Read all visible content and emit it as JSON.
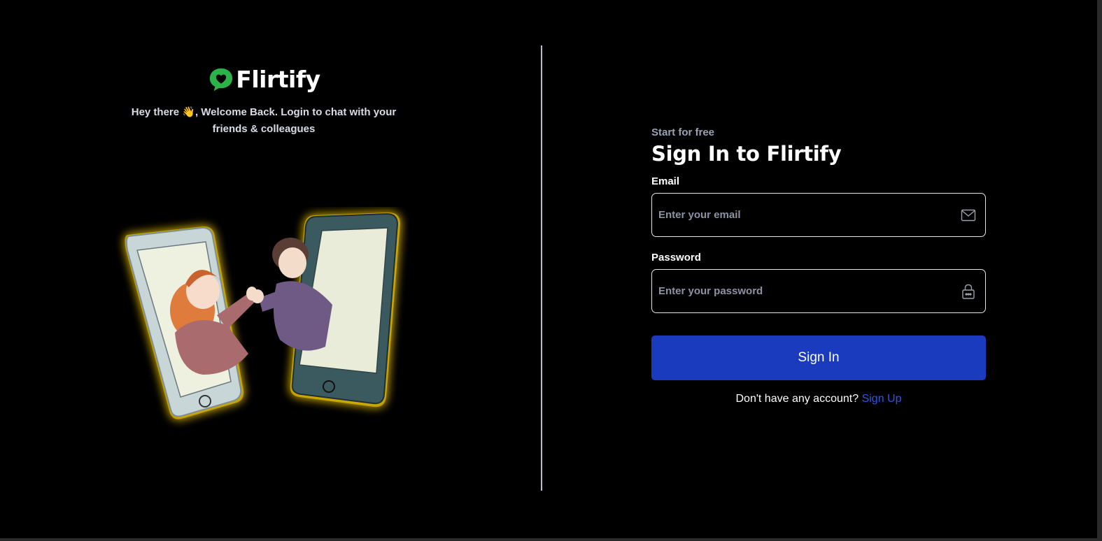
{
  "brand": {
    "name": "Flirtify",
    "tagline": "Hey there 👋, Welcome Back. Login to chat with your friends & colleagues"
  },
  "colors": {
    "background": "#000000",
    "accent": "#1a3bbd",
    "link": "#2f56e8",
    "logo": "#2bb34a",
    "glow": "#ffd200"
  },
  "form": {
    "eyebrow": "Start for free",
    "title": "Sign In to Flirtify",
    "email": {
      "label": "Email",
      "placeholder": "Enter your email",
      "value": "",
      "icon": "envelope-icon"
    },
    "password": {
      "label": "Password",
      "placeholder": "Enter your password",
      "value": "",
      "icon": "lock-icon"
    },
    "submit_label": "Sign In",
    "signup_prompt": "Don't have any account?",
    "signup_link": "Sign Up"
  }
}
